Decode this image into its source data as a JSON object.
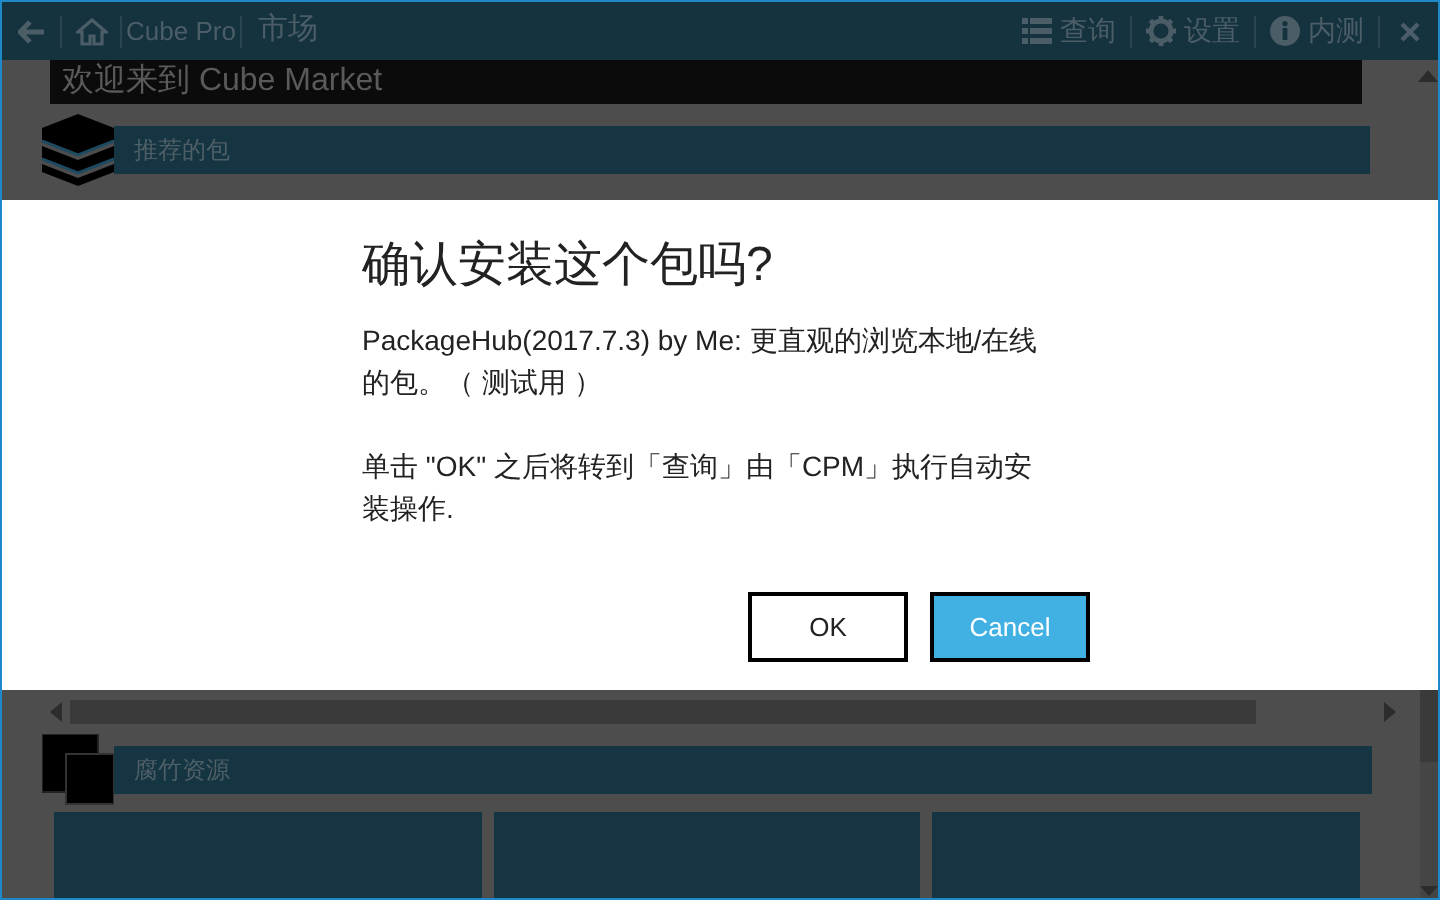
{
  "title_bar": {
    "app_name": "Cube Pro",
    "page_title": "市场",
    "actions": [
      {
        "label": "查询",
        "kind": "list"
      },
      {
        "label": "设置",
        "kind": "gear"
      },
      {
        "label": "内测",
        "kind": "info"
      }
    ]
  },
  "welcome": "欢迎来到 Cube Market",
  "sections": [
    {
      "title": "推荐的包",
      "kind": "stack"
    },
    {
      "title": "腐竹资源",
      "kind": "squares"
    }
  ],
  "dialog": {
    "title": "确认安装这个包吗?",
    "paragraphs": [
      "PackageHub(2017.7.3) by Me: 更直观的浏览本地/在线的包。（ 测试用 ）",
      "单击 \"OK\" 之后将转到「查询」由「CPM」执行自动安装操作."
    ],
    "buttons": [
      {
        "label": "OK",
        "focused": false
      },
      {
        "label": "Cancel",
        "focused": true
      }
    ]
  }
}
